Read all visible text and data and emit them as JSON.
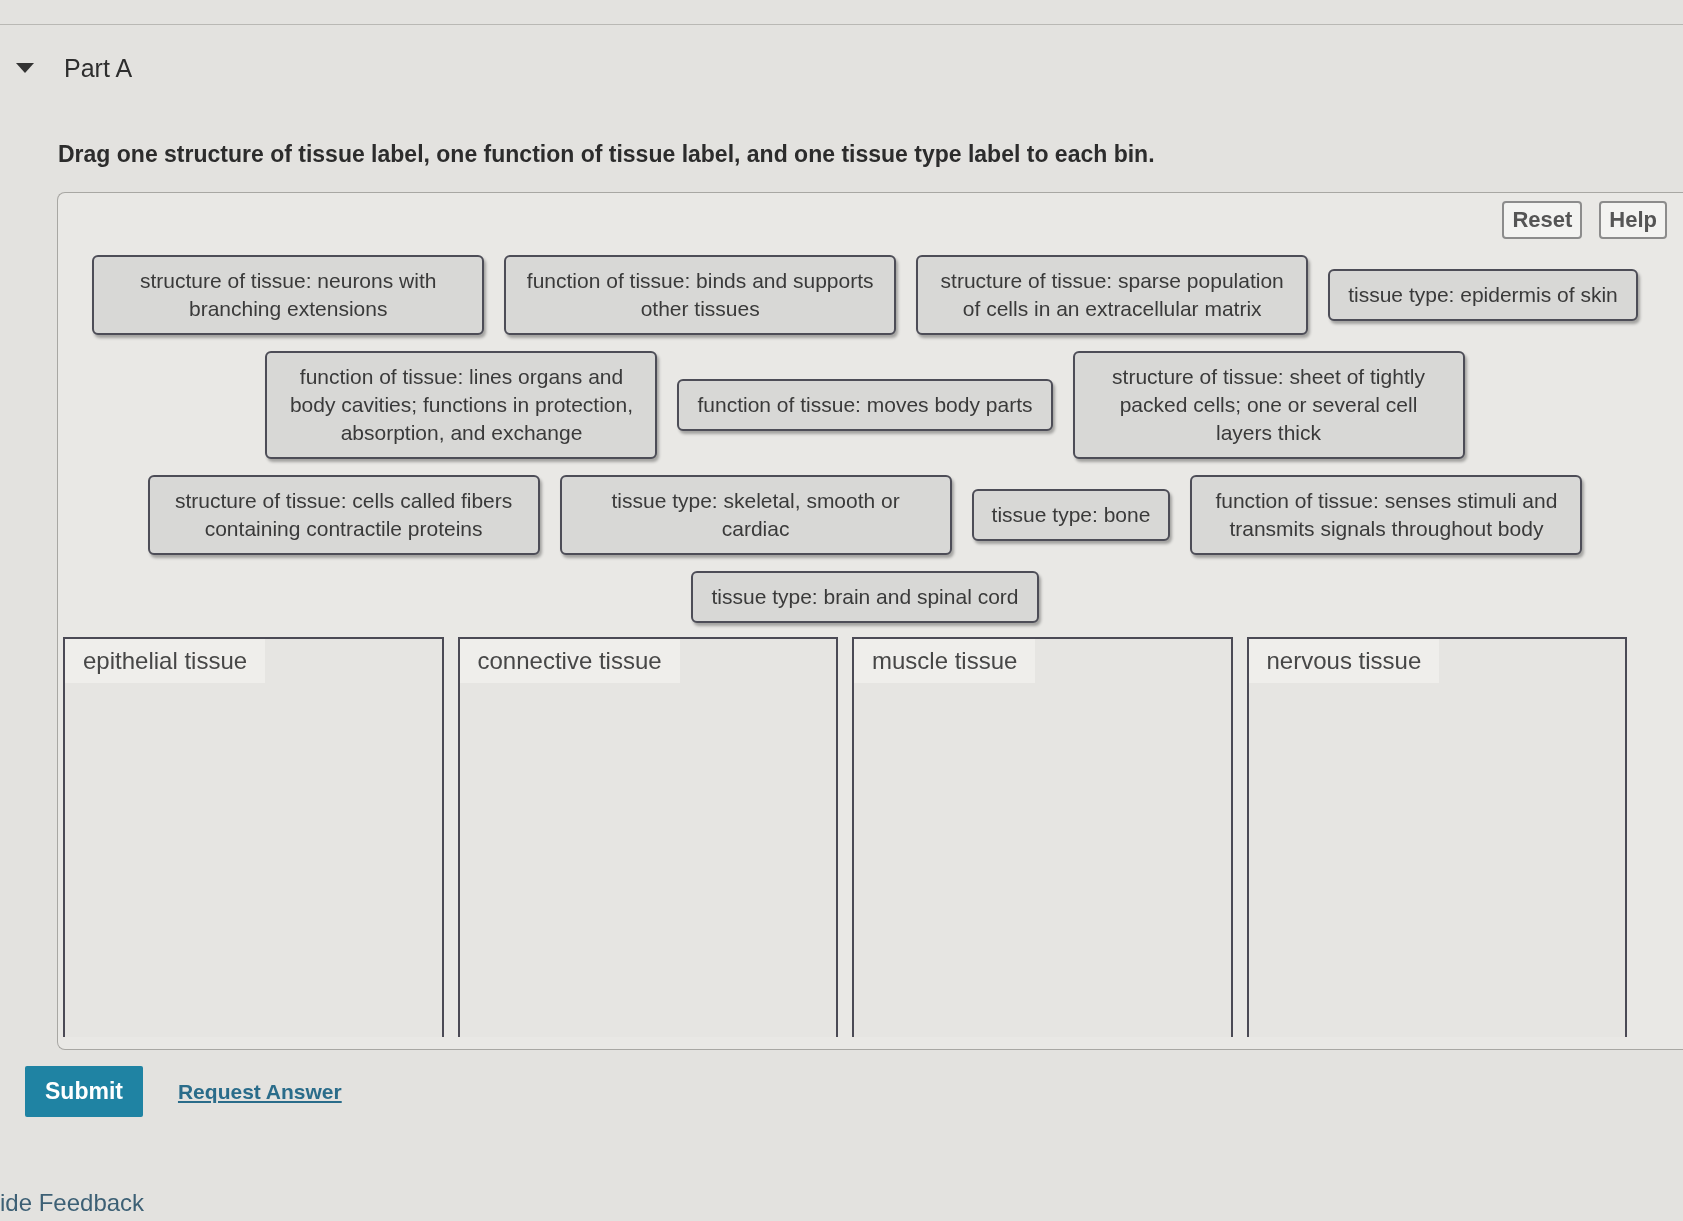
{
  "part": {
    "title": "Part A",
    "expanded": true
  },
  "instruction": "Drag one structure of tissue label, one function of tissue label, and one tissue type label to each bin.",
  "toolbar": {
    "buttons": [
      "Reset",
      "Help"
    ]
  },
  "label_rows": [
    [
      {
        "text": "structure of tissue: neurons with branching extensions"
      },
      {
        "text": "function of tissue: binds and supports other tissues"
      },
      {
        "text": "structure of tissue: sparse population of cells in an extracellular matrix"
      },
      {
        "text": "tissue type: epidermis of skin"
      }
    ],
    [
      {
        "text": "function of tissue: lines organs and body cavities; functions in protection, absorption, and exchange"
      },
      {
        "text": "function of tissue: moves body parts"
      },
      {
        "text": "structure of tissue: sheet of tightly packed cells; one or several cell layers thick"
      }
    ],
    [
      {
        "text": "structure of tissue: cells called fibers containing contractile proteins"
      },
      {
        "text": "tissue type: skeletal, smooth or cardiac"
      },
      {
        "text": "tissue type: bone"
      },
      {
        "text": "function of tissue: senses stimuli and transmits signals throughout body"
      }
    ],
    [
      {
        "text": "tissue type: brain and spinal cord"
      }
    ]
  ],
  "bins": [
    {
      "title": "epithelial tissue"
    },
    {
      "title": "connective tissue"
    },
    {
      "title": "muscle tissue"
    },
    {
      "title": "nervous tissue"
    }
  ],
  "submit": "Submit",
  "request_answer": "Request Answer",
  "feedback_link": "ide Feedback"
}
